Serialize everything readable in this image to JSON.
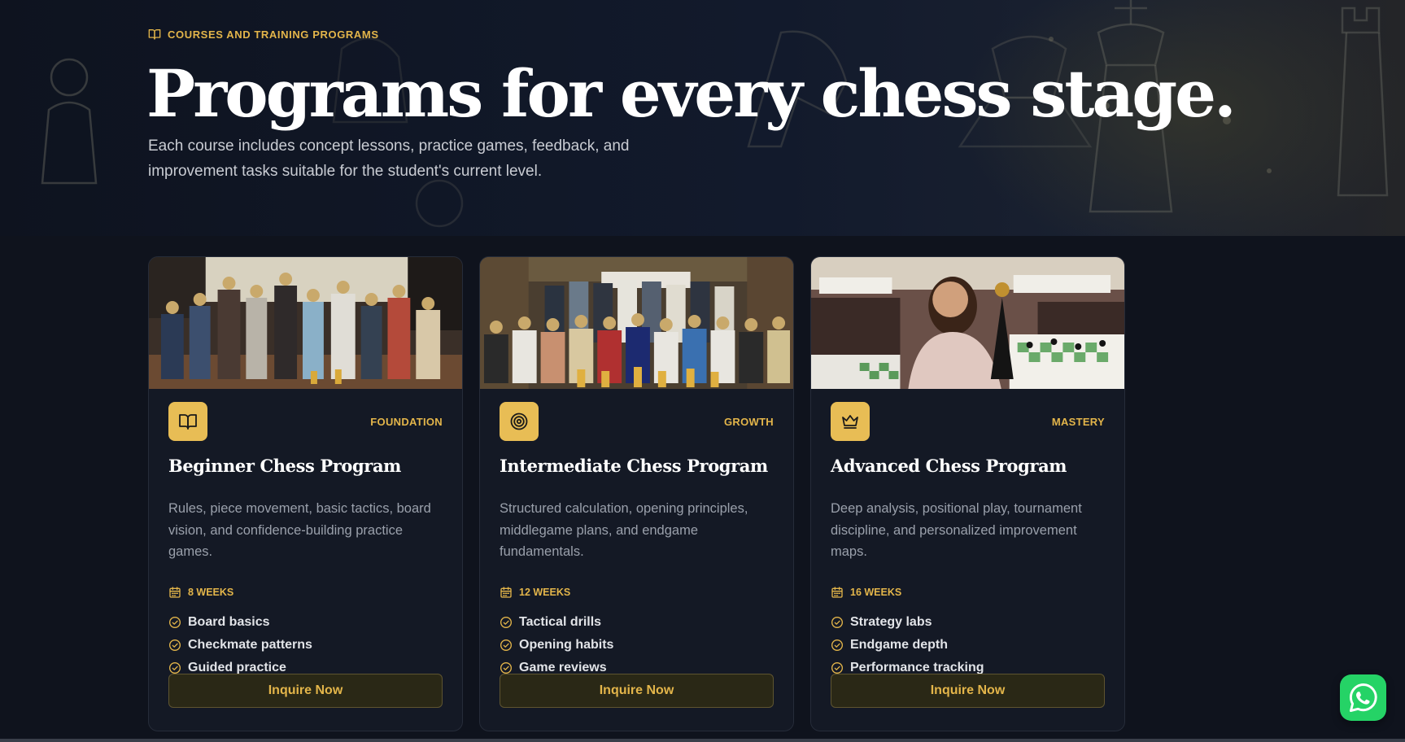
{
  "hero": {
    "eyebrow": "COURSES AND TRAINING PROGRAMS",
    "eyebrow_icon": "book-open-icon",
    "title": "Programs for every chess stage.",
    "subtitle": "Each course includes concept lessons, practice games, feedback, and improvement tasks suitable for the student's current level."
  },
  "cards": [
    {
      "photo": "group-photo-students-with-trophies",
      "icon": "book-open-icon",
      "level": "FOUNDATION",
      "title": "Beginner Chess Program",
      "description": "Rules, piece movement, basic tactics, board vision, and confidence-building practice games.",
      "duration": "8 WEEKS",
      "features": [
        "Board basics",
        "Checkmate patterns",
        "Guided practice"
      ],
      "button": "Inquire Now"
    },
    {
      "photo": "school-group-photo-with-trophies",
      "icon": "target-icon",
      "level": "GROWTH",
      "title": "Intermediate Chess Program",
      "description": "Structured calculation, opening principles, middlegame plans, and endgame fundamentals.",
      "duration": "12 WEEKS",
      "features": [
        "Tactical drills",
        "Opening habits",
        "Game reviews"
      ],
      "button": "Inquire Now"
    },
    {
      "photo": "girl-with-trophy-at-chess-tournament",
      "icon": "crown-icon",
      "level": "MASTERY",
      "title": "Advanced Chess Program",
      "description": "Deep analysis, positional play, tournament discipline, and personalized improvement maps.",
      "duration": "16 WEEKS",
      "features": [
        "Strategy labs",
        "Endgame depth",
        "Performance tracking"
      ],
      "button": "Inquire Now"
    }
  ],
  "colors": {
    "accent": "#e3b54a",
    "background": "#0f131d",
    "card": "#141925",
    "whatsapp": "#25d366"
  },
  "floating": {
    "icon": "whatsapp-icon"
  }
}
